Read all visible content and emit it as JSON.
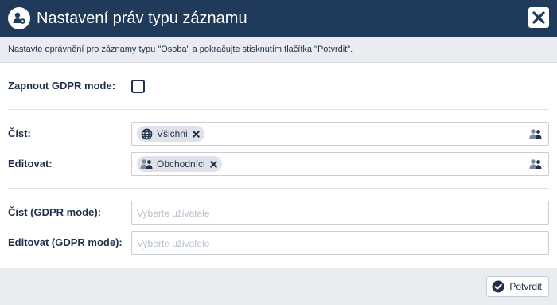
{
  "dialog": {
    "title": "Nastavení práv typu záznamu",
    "info": "Nastavte oprávnění pro záznamy typu \"Osoba\" a pokračujte stisknutím tlačítka \"Potvrdit\"."
  },
  "form": {
    "gdpr_label": "Zapnout GDPR mode:",
    "gdpr_checked": false,
    "read_label": "Číst:",
    "read_tag": "Všichni",
    "edit_label": "Editovat:",
    "edit_tag": "Obchodníci",
    "read_gdpr_label": "Číst (GDPR mode):",
    "read_gdpr_placeholder": "Vyberte uživatele",
    "edit_gdpr_label": "Editovat (GDPR mode):",
    "edit_gdpr_placeholder": "Vyberte uživatele"
  },
  "footer": {
    "confirm_label": "Potvrdit"
  },
  "colors": {
    "header_bg": "#203a5c",
    "text": "#1f3048",
    "panel_bg": "#e9ecf1"
  }
}
